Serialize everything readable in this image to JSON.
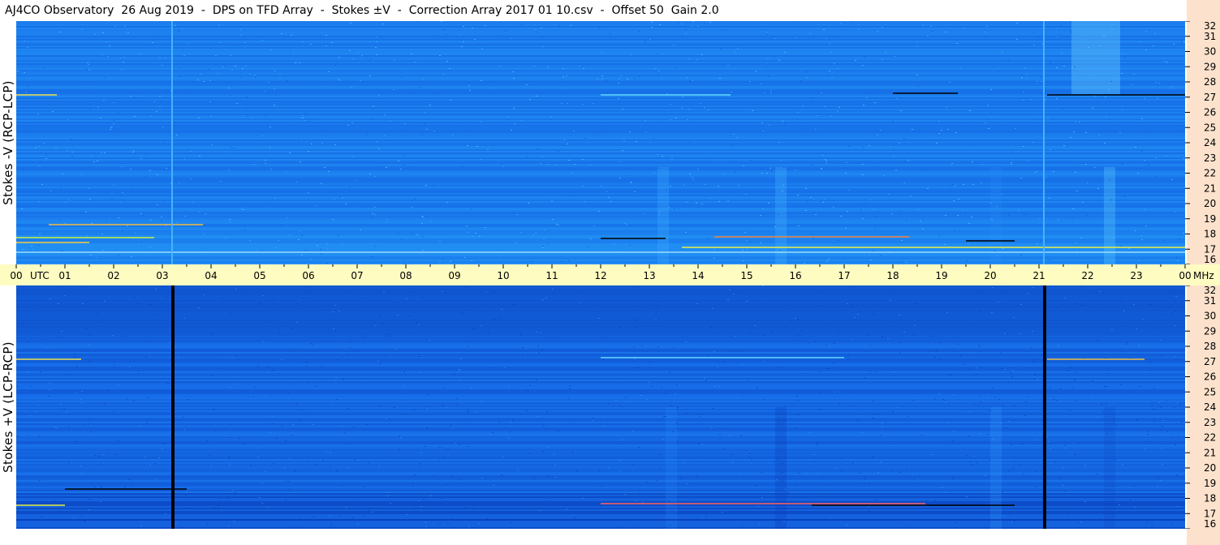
{
  "title": "AJ4CO Observatory  26 Aug 2019  -  DPS on TFD Array  -  Stokes ±V  -  Correction Array 2017 01 10.csv  -  Offset 50  Gain 2.0",
  "colors": {
    "panel_top_base": "#1a78ec",
    "panel_bottom_base": "#1466e0",
    "axis_band": "#fffcc2",
    "freq_strip": "#fce2cc"
  },
  "chart_data": [
    {
      "type": "heatmap",
      "panel": "top",
      "ylabel": "Stokes -V (RCP-LCP)",
      "y_unit": "MHz",
      "ylim": [
        16,
        32
      ],
      "xlim": [
        0,
        24
      ],
      "y_ticks": [
        "16",
        "17",
        "18",
        "19",
        "20",
        "21",
        "22",
        "23",
        "24",
        "25",
        "26",
        "27",
        "28",
        "29",
        "30",
        "31",
        "32"
      ]
    },
    {
      "type": "heatmap",
      "panel": "bottom",
      "ylabel": "Stokes +V (LCP-RCP)",
      "y_unit": "MHz",
      "ylim": [
        16,
        32
      ],
      "xlim": [
        0,
        24
      ],
      "y_ticks": [
        "16",
        "17",
        "18",
        "19",
        "20",
        "21",
        "22",
        "23",
        "24",
        "25",
        "26",
        "27",
        "28",
        "29",
        "30",
        "31",
        "32"
      ]
    }
  ],
  "time_axis": {
    "unit": "UTC",
    "freq_unit": "MHz",
    "labels": [
      "00",
      "01",
      "02",
      "03",
      "04",
      "05",
      "06",
      "07",
      "08",
      "09",
      "10",
      "11",
      "12",
      "13",
      "14",
      "15",
      "16",
      "17",
      "18",
      "19",
      "20",
      "21",
      "22",
      "23",
      "00"
    ]
  }
}
